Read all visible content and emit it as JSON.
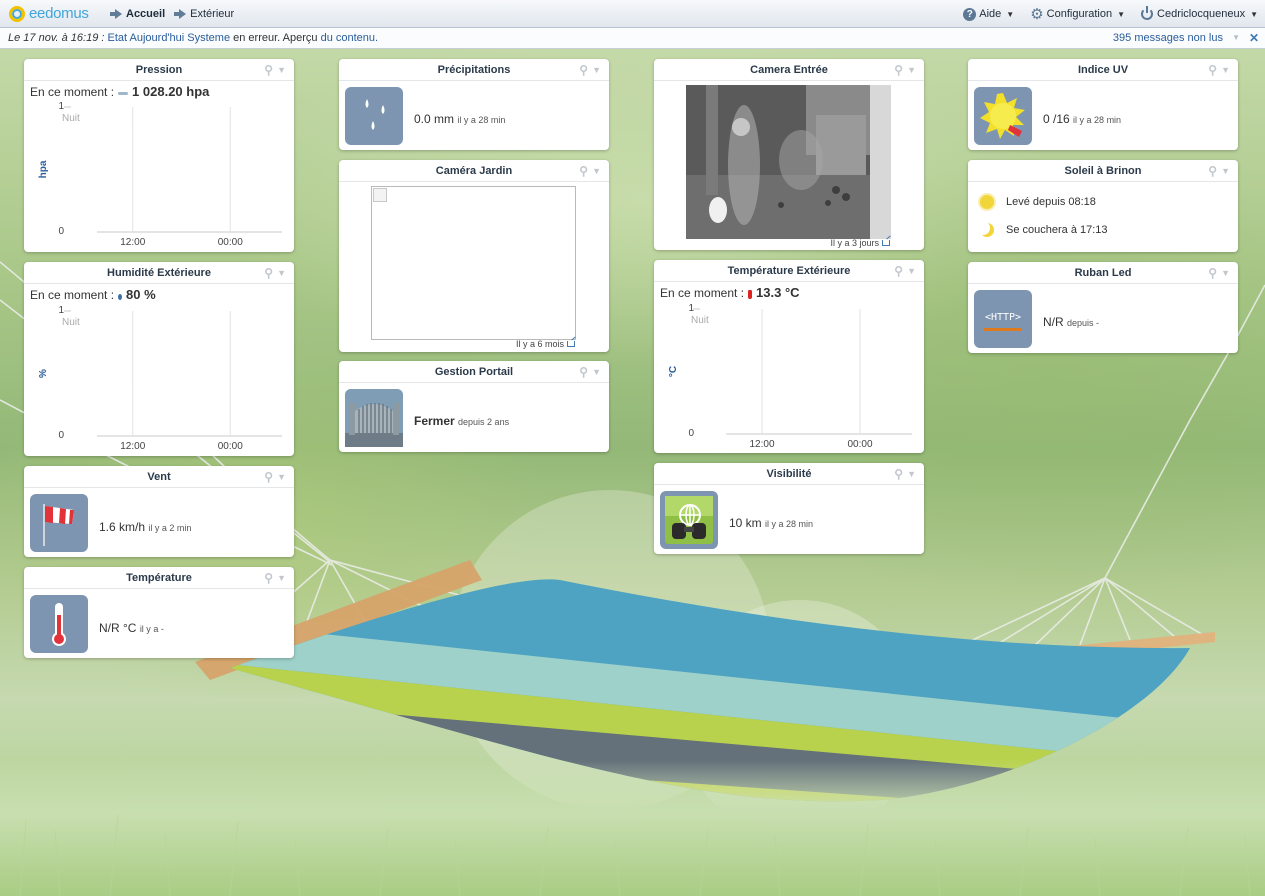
{
  "app": {
    "logo_text": "eedomus",
    "nav": [
      {
        "label": "Accueil"
      },
      {
        "label": "Extérieur"
      }
    ],
    "help_label": "Aide",
    "config_label": "Configuration",
    "user_label": "Cedriclocqueneux"
  },
  "infobar": {
    "date": "Le 17 nov. à 16:19 :",
    "link1": "Etat Aujourd'hui Systeme",
    "text1": "en erreur. Aperçu",
    "link2": "du contenu.",
    "messages": "395 messages non lus"
  },
  "widgets": {
    "pression": {
      "title": "Pression",
      "now_label": "En ce moment :",
      "now_value": "1 028.20 hpa",
      "chart_data": {
        "type": "line",
        "ylabel": "hpa",
        "ylim": [
          0,
          1
        ],
        "yticks": [
          "1",
          "0"
        ],
        "xticks": [
          "12:00",
          "00:00"
        ],
        "annotation": "Nuit",
        "series": []
      }
    },
    "humidite": {
      "title": "Humidité Extérieure",
      "now_label": "En ce moment :",
      "now_value": "80 %",
      "chart_data": {
        "type": "line",
        "ylabel": "%",
        "ylim": [
          0,
          1
        ],
        "yticks": [
          "1",
          "0"
        ],
        "xticks": [
          "12:00",
          "00:00"
        ],
        "annotation": "Nuit",
        "series": []
      }
    },
    "vent": {
      "title": "Vent",
      "value": "1.6 km/h",
      "since": "il y a 2 min"
    },
    "temperature": {
      "title": "Température",
      "value": "N/R °C",
      "since": "il y a -"
    },
    "precipitations": {
      "title": "Précipitations",
      "value": "0.0 mm",
      "since": "il y a 28 min"
    },
    "camera_jardin": {
      "title": "Caméra Jardin",
      "footer": "Il y a 6 mois"
    },
    "gestion_portail": {
      "title": "Gestion Portail",
      "value": "Fermer",
      "since": "depuis 2 ans"
    },
    "camera_entree": {
      "title": "Camera Entrée",
      "footer": "Il y a 3 jours"
    },
    "temperature_ext": {
      "title": "Température Extérieure",
      "now_label": "En ce moment :",
      "now_value": "13.3 °C",
      "chart_data": {
        "type": "line",
        "ylabel": "°C",
        "ylim": [
          0,
          1
        ],
        "yticks": [
          "1",
          "0"
        ],
        "xticks": [
          "12:00",
          "00:00"
        ],
        "annotation": "Nuit",
        "series": []
      }
    },
    "visibilite": {
      "title": "Visibilité",
      "value": "10 km",
      "since": "il y a 28 min"
    },
    "indice_uv": {
      "title": "Indice UV",
      "value": "0 /16",
      "since": "il y a 28 min"
    },
    "soleil": {
      "title": "Soleil à Brinon",
      "rise": "Levé depuis 08:18",
      "set": "Se couchera à 17:13"
    },
    "ruban_led": {
      "title": "Ruban Led",
      "value": "N/R",
      "since": "depuis -",
      "icon_text": "<HTTP>"
    }
  },
  "colors": {
    "accent": "#2a5d9c",
    "tile": "#7d95b0",
    "logo_blue": "#3ea6dc",
    "logo_yellow": "#f2c200"
  }
}
